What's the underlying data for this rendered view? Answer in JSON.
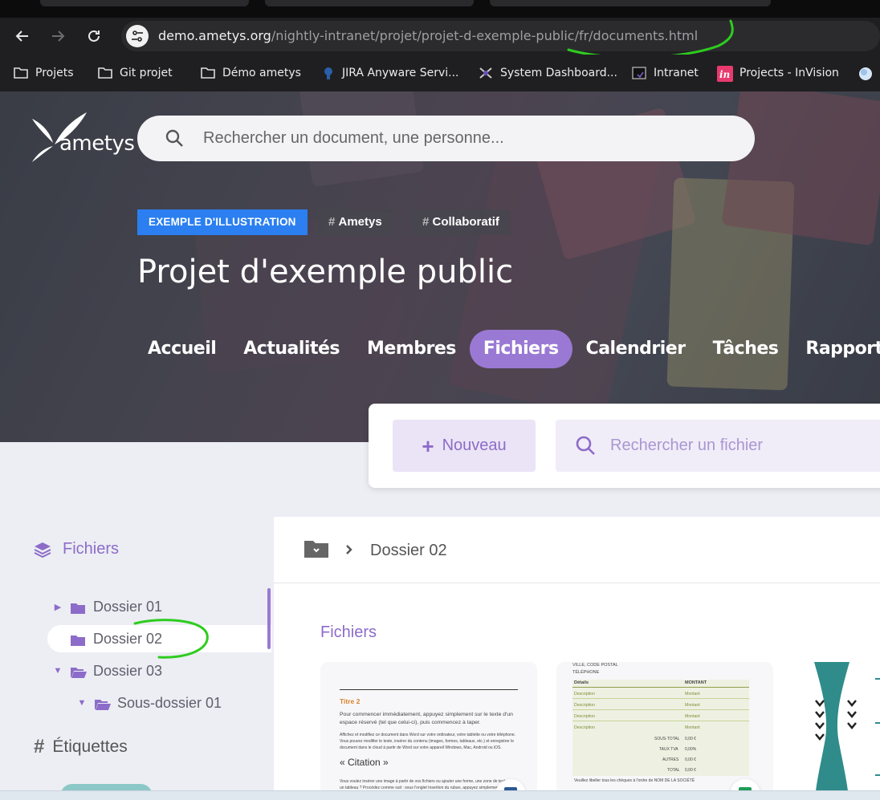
{
  "browser": {
    "url_host": "demo.ametys.org",
    "url_path": "/nightly-intranet/projet/projet-d-exemple-public/fr/documents.html",
    "bookmarks": [
      {
        "label": "Projets",
        "icon": "folder-icon"
      },
      {
        "label": "Git projet",
        "icon": "folder-icon"
      },
      {
        "label": "Démo ametys",
        "icon": "folder-icon"
      },
      {
        "label": "JIRA Anyware Servi...",
        "icon": "jira-icon"
      },
      {
        "label": "System Dashboard...",
        "icon": "dashboard-icon"
      },
      {
        "label": "Intranet",
        "icon": "intranet-icon"
      },
      {
        "label": "Projects - InVision",
        "icon": "invision-icon"
      }
    ]
  },
  "header": {
    "logo_text": "ametys",
    "search_placeholder": "Rechercher un document, une personne..."
  },
  "project": {
    "tags": [
      "EXEMPLE D'ILLUSTRATION",
      "Ametys",
      "Collaboratif"
    ],
    "title": "Projet d'exemple public",
    "nav": [
      "Accueil",
      "Actualités",
      "Membres",
      "Fichiers",
      "Calendrier",
      "Tâches",
      "Rapports"
    ],
    "active_nav": "Fichiers"
  },
  "files_toolbar": {
    "new_label": "Nouveau",
    "search_placeholder": "Rechercher un fichier"
  },
  "sidebar": {
    "heading": "Fichiers",
    "tree": [
      {
        "label": "Dossier 01",
        "expanded": false,
        "has_children": true
      },
      {
        "label": "Dossier 02",
        "selected": true
      },
      {
        "label": "Dossier 03",
        "expanded": true,
        "has_children": true
      },
      {
        "label": "Sous-dossier 01",
        "expanded": true,
        "has_children": true
      }
    ],
    "labels_heading": "Étiquettes"
  },
  "main": {
    "breadcrumb_current": "Dossier 02",
    "section_title": "Fichiers",
    "card1": {
      "heading": "Titre 2",
      "para1": "Pour commencer immédiatement, appuyez simplement sur le texte d'un espace réservé (tel que celui-ci), puis commencez à taper.",
      "para2": "Affichez et modifiez ce document dans Word sur votre ordinateur, votre tablette ou votre téléphone. Vous pouvez modifier le texte, insérer du contenu (images, formes, tableaux, etc.) et enregistrer le document dans le cloud à partir de Word sur votre appareil Windows, Mac, Android ou iOS.",
      "quote": "« Citation »",
      "para3": "Vous voulez insérer une image à partir de vos fichiers ou ajouter une forme, une zone de texte ou un tableau ? Procédez comme suit : sous l'onglet Insertion du ruban, appuyez simplement"
    },
    "card2": {
      "top1": "VILLE, CODE POSTAL",
      "top2": "TÉLÉPHONE",
      "col1": "Détails",
      "col2": "MONTANT",
      "row_desc": "Description",
      "row_amount": "Montant",
      "sub_total": "SOUS-TOTAL",
      "sub_total_val": "0,00 €",
      "tax_rate": "TAUX TVA",
      "tax_rate_val": "0,00%",
      "others": "AUTRES",
      "others_val": "0,00 €",
      "total": "TOTAL",
      "total_val": "0,00 €",
      "footer": "Veuillez libeller tous les chèques à l'ordre de NOM DE LA SOCIÉTÉ"
    }
  }
}
